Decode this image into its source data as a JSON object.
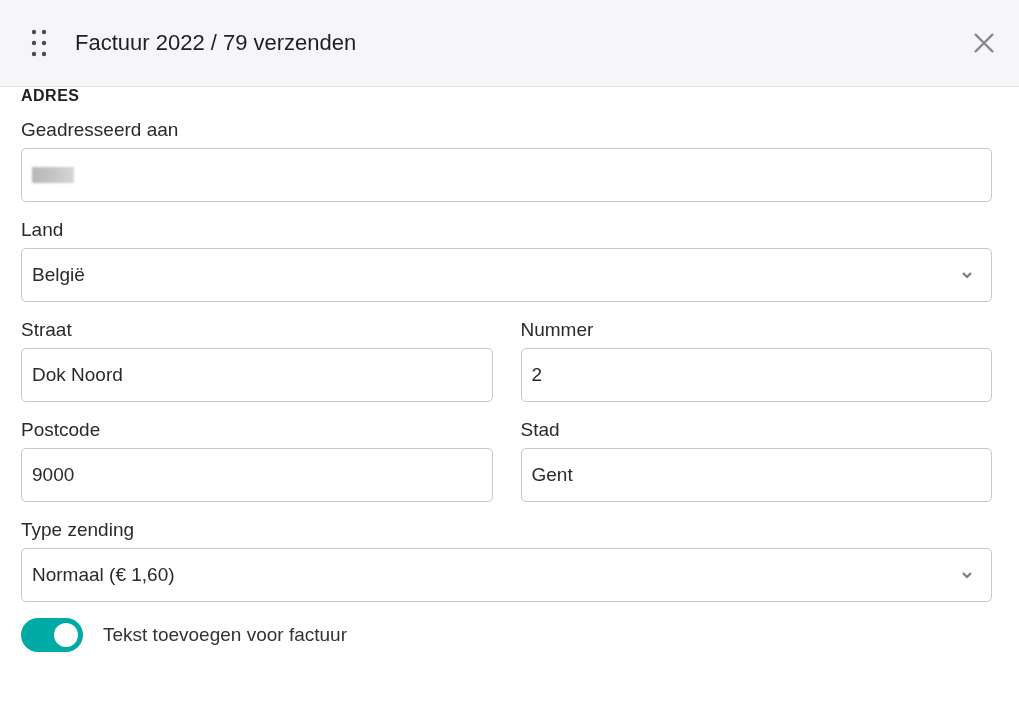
{
  "dialog": {
    "title": "Factuur 2022 / 79 verzenden"
  },
  "section": {
    "title": "ADRES"
  },
  "rows": [
    [
      {
        "label": "Geadresseerd aan",
        "kind": "text",
        "redacted": true
      }
    ],
    [
      {
        "label": "Land",
        "kind": "select",
        "value": "België"
      }
    ],
    [
      {
        "label": "Straat",
        "kind": "text",
        "value": "Dok Noord"
      },
      {
        "label": "Nummer",
        "kind": "text",
        "value": "2"
      }
    ],
    [
      {
        "label": "Postcode",
        "kind": "text",
        "value": "9000"
      },
      {
        "label": "Stad",
        "kind": "text",
        "value": "Gent"
      }
    ],
    [
      {
        "label": "Type zending",
        "kind": "select",
        "value": "Normaal (€ 1,60)"
      }
    ]
  ],
  "toggle": {
    "label": "Tekst toevoegen voor factuur",
    "on": true
  }
}
